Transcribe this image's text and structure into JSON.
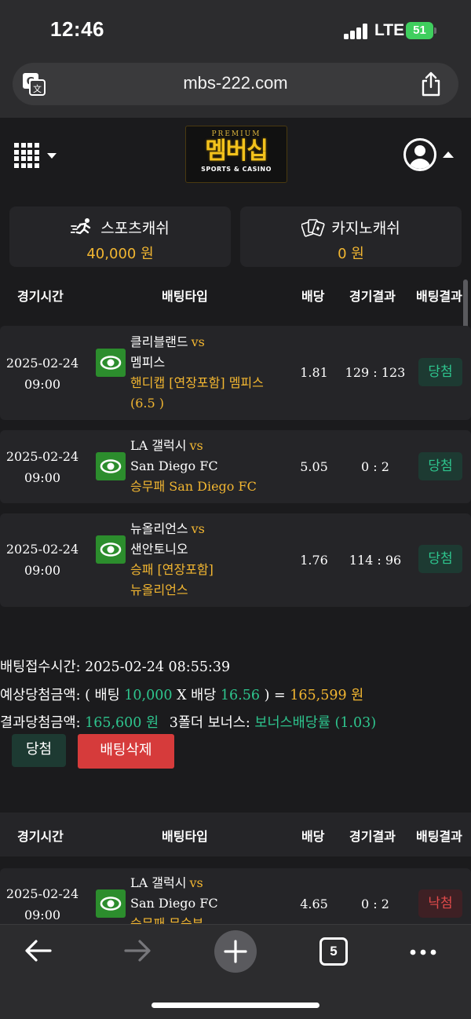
{
  "status_bar": {
    "time": "12:46",
    "network": "LTE",
    "battery": "51"
  },
  "browser": {
    "url": "mbs-222.com",
    "tab_count": "5"
  },
  "site": {
    "logo": {
      "top": "PREMIUM",
      "main": "멤버십",
      "sub": "SPORTS & CASINO"
    }
  },
  "cash": {
    "sports": {
      "label": "스포츠캐쉬",
      "amount": "40,000 원"
    },
    "casino": {
      "label": "카지노캐쉬",
      "amount": "0 원"
    }
  },
  "table_headers": {
    "time": "경기시간",
    "type": "배팅타입",
    "odds": "배당",
    "score": "경기결과",
    "result": "배팅결과"
  },
  "bet_slip_1": {
    "rows": [
      {
        "date": "2025-02-24",
        "time": "09:00",
        "home": "클리블랜드",
        "vs": "vs",
        "away": "멤피스",
        "pick_line1": "핸디캡 [연장포함] 멤피스",
        "pick_line2": "(6.5 )",
        "odds": "1.81",
        "score": "129 : 123",
        "result": "당첨"
      },
      {
        "date": "2025-02-24",
        "time": "09:00",
        "home": "LA 갤럭시",
        "vs": "vs",
        "away": "San Diego FC",
        "pick_line1": "승무패 San Diego FC",
        "odds": "5.05",
        "score": "0 : 2",
        "result": "당첨"
      },
      {
        "date": "2025-02-24",
        "time": "09:00",
        "home": "뉴올리언스",
        "vs": "vs",
        "away": "샌안토니오",
        "pick_line1": "승패 [연장포함]",
        "pick_line2": "뉴올리언스",
        "odds": "1.76",
        "score": "114 : 96",
        "result": "당첨"
      }
    ],
    "summary": {
      "accept_label": "배팅접수시간:",
      "accept_time": "2025-02-24 08:55:39",
      "expected_label": "예상당첨금액:",
      "open_paren": "(",
      "bet_label": "배팅",
      "bet_amount": "10,000",
      "x": "X",
      "odds_label": "배당",
      "total_odds": "16.56",
      "close_eq": ") =",
      "expected_amount": "165,599 원",
      "result_label": "결과당첨금액:",
      "result_amount": "165,600 원",
      "bonus_label": "3폴더 보너스:",
      "bonus_value": "보너스배당률 (1.03)"
    },
    "buttons": {
      "win": "당첨",
      "delete": "배팅삭제"
    }
  },
  "bet_slip_2": {
    "rows": [
      {
        "date": "2025-02-24",
        "time": "09:00",
        "home": "LA 갤럭시",
        "vs": "vs",
        "away": "San Diego FC",
        "pick_line1": "승무패 무승부",
        "odds": "4.65",
        "score": "0 : 2",
        "result": "낙첨"
      }
    ]
  },
  "colors": {
    "background": "#1b1b1d",
    "row": "#252528",
    "accent_yellow": "#f2b631",
    "win_green": "#2ec58e",
    "lose_red": "#e04a4a",
    "delete_red": "#d63b3b",
    "eye_green": "#2c8d2d"
  }
}
